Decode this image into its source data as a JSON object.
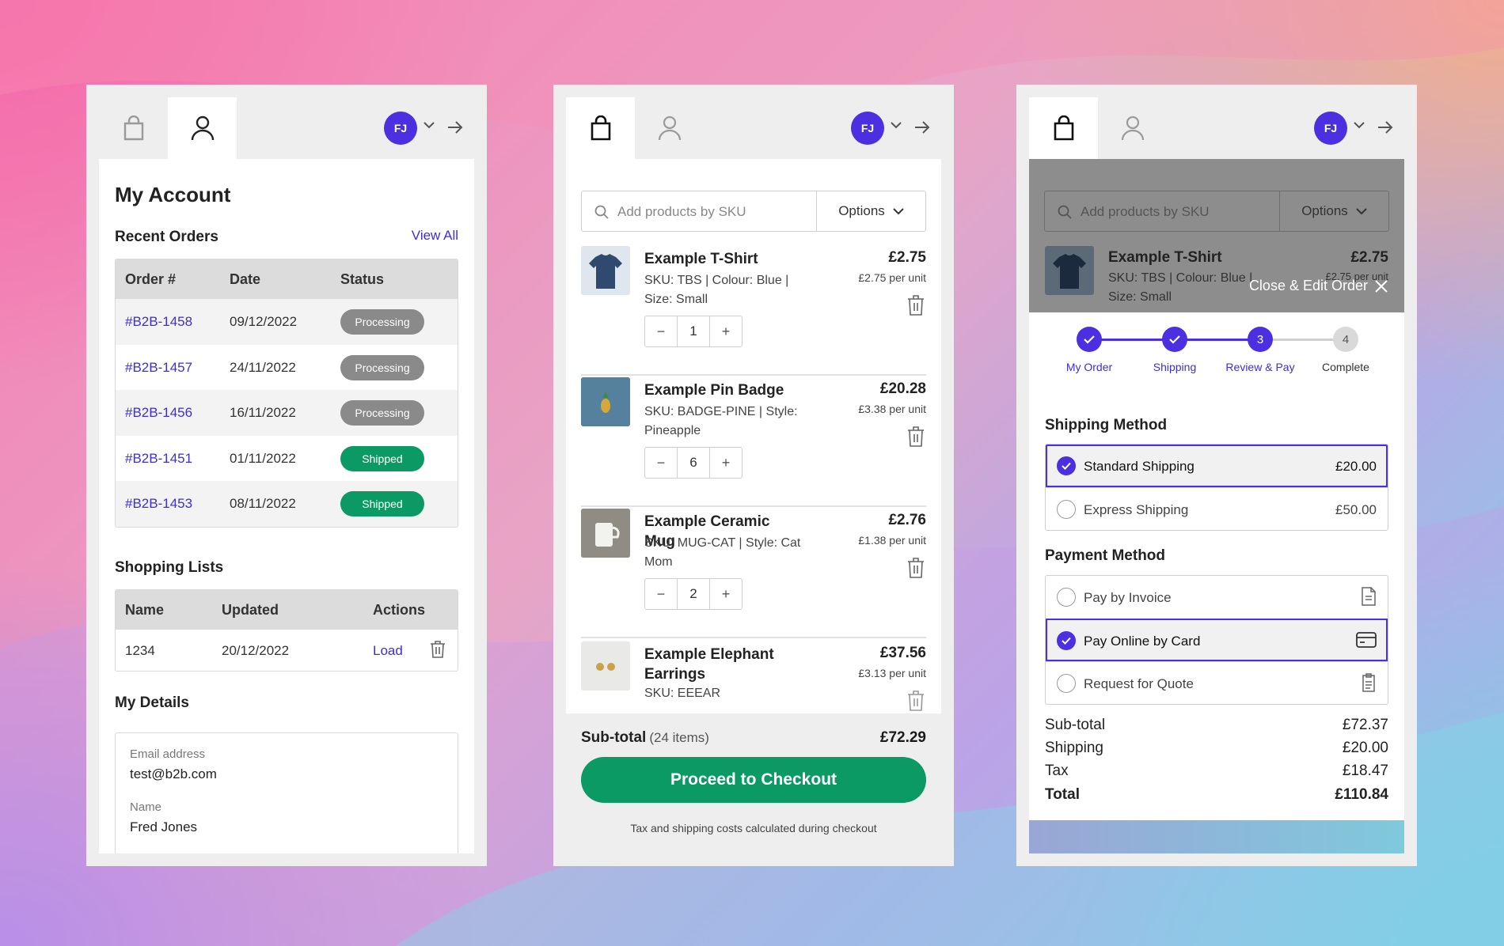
{
  "colors": {
    "accent": "#4b2fe0",
    "success": "#0b9a63",
    "processing": "#8a8a8a"
  },
  "account": {
    "avatar": "FJ",
    "title": "My Account",
    "recent_orders": {
      "heading": "Recent Orders",
      "view_all": "View All",
      "headers": [
        "Order #",
        "Date",
        "Status"
      ],
      "rows": [
        {
          "order": "#B2B-1458",
          "date": "09/12/2022",
          "status": "Processing"
        },
        {
          "order": "#B2B-1457",
          "date": "24/11/2022",
          "status": "Processing"
        },
        {
          "order": "#B2B-1456",
          "date": "16/11/2022",
          "status": "Processing"
        },
        {
          "order": "#B2B-1451",
          "date": "01/11/2022",
          "status": "Shipped"
        },
        {
          "order": "#B2B-1453",
          "date": "08/11/2022",
          "status": "Shipped"
        }
      ]
    },
    "shopping_lists": {
      "heading": "Shopping Lists",
      "headers": [
        "Name",
        "Updated",
        "Actions"
      ],
      "rows": [
        {
          "name": "1234",
          "updated": "20/12/2022",
          "action": "Load"
        }
      ]
    },
    "details": {
      "heading": "My Details",
      "email_label": "Email address",
      "email": "test@b2b.com",
      "name_label": "Name",
      "name": "Fred Jones"
    }
  },
  "cart": {
    "avatar": "FJ",
    "search_placeholder": "Add products by SKU",
    "options_label": "Options",
    "items": [
      {
        "name": "Example T-Shirt",
        "sku": "SKU: TBS | Colour: Blue | Size: Small",
        "price": "£2.75",
        "unit": "£2.75 per unit",
        "qty": "1"
      },
      {
        "name": "Example Pin Badge",
        "sku": "SKU: BADGE-PINE | Style: Pineapple",
        "price": "£20.28",
        "unit": "£3.38 per unit",
        "qty": "6"
      },
      {
        "name": "Example Ceramic Mug",
        "sku": "SKU: MUG-CAT | Style: Cat Mom",
        "price": "£2.76",
        "unit": "£1.38 per unit",
        "qty": "2"
      },
      {
        "name": "Example Elephant Earrings",
        "sku": "SKU: EEEAR",
        "price": "£37.56",
        "unit": "£3.13 per unit"
      }
    ],
    "subtotal_label": "Sub-total",
    "subtotal_count": "(24 items)",
    "subtotal_value": "£72.29",
    "checkout_label": "Proceed to Checkout",
    "note": "Tax and shipping costs calculated during checkout"
  },
  "checkout": {
    "avatar": "FJ",
    "search_placeholder": "Add products by SKU",
    "options_label": "Options",
    "preview_item": {
      "name": "Example T-Shirt",
      "sku": "SKU: TBS | Colour: Blue |",
      "size": "Size: Small",
      "price": "£2.75",
      "unit": "£2.75 per unit"
    },
    "close_edit": "Close & Edit Order",
    "steps": [
      {
        "label": "My Order",
        "state": "done"
      },
      {
        "label": "Shipping",
        "state": "done"
      },
      {
        "label": "Review & Pay",
        "state": "current",
        "number": "3"
      },
      {
        "label": "Complete",
        "state": "todo",
        "number": "4"
      }
    ],
    "shipping_heading": "Shipping Method",
    "shipping_options": [
      {
        "label": "Standard Shipping",
        "price": "£20.00",
        "selected": true
      },
      {
        "label": "Express Shipping",
        "price": "£50.00",
        "selected": false
      }
    ],
    "payment_heading": "Payment Method",
    "payment_options": [
      {
        "label": "Pay by Invoice",
        "icon": "document-icon",
        "selected": false
      },
      {
        "label": "Pay Online by Card",
        "icon": "credit-card-icon",
        "selected": true
      },
      {
        "label": "Request for Quote",
        "icon": "clipboard-icon",
        "selected": false
      }
    ],
    "summary": [
      {
        "label": "Sub-total",
        "value": "£72.37"
      },
      {
        "label": "Shipping",
        "value": "£20.00"
      },
      {
        "label": "Tax",
        "value": "£18.47"
      },
      {
        "label": "Total",
        "value": "£110.84"
      }
    ]
  }
}
